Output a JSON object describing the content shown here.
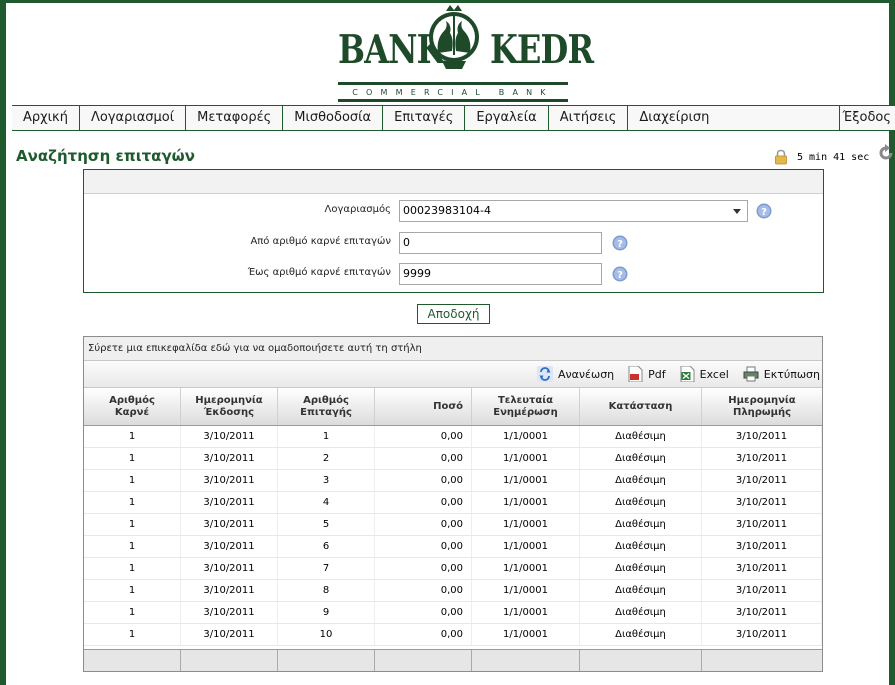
{
  "brand": {
    "left_word": "BANK",
    "right_word": "KEDR",
    "subtitle": "COMMERCIAL BANK",
    "color": "#1f4a2a"
  },
  "nav": {
    "items": [
      "Αρχική",
      "Λογαριασμοί",
      "Μεταφορές",
      "Μισθοδοσία",
      "Επιταγές",
      "Εργαλεία",
      "Αιτήσεις",
      "Διαχείριση"
    ],
    "exit_label": "Έξοδος"
  },
  "page": {
    "title": "Αναζήτηση επιταγών",
    "session_time": "5 min 41 sec"
  },
  "form": {
    "account_label": "Λογαριασμός",
    "account_value": "00023983104-4",
    "from_label": "Από αριθμό καρνέ επιταγών",
    "from_value": "0",
    "to_label": "Έως αριθμό καρνέ επιταγών",
    "to_value": "9999",
    "accept_label": "Αποδοχή"
  },
  "grid": {
    "group_hint": "Σύρετε μια επικεφαλίδα εδώ για να ομαδοποιήσετε αυτή τη στήλη",
    "toolbar": {
      "refresh": "Ανανέωση",
      "pdf": "Pdf",
      "excel": "Excel",
      "print": "Εκτύπωση"
    },
    "headers": [
      [
        "Αριθμός",
        "Καρνέ"
      ],
      [
        "Ημερομηνία",
        "Έκδοσης"
      ],
      [
        "Αριθμός",
        "Επιταγής"
      ],
      [
        "Ποσό",
        ""
      ],
      [
        "Τελευταία",
        "Ενημέρωση"
      ],
      [
        "Κατάσταση",
        ""
      ],
      [
        "Ημερομηνία",
        "Πληρωμής"
      ]
    ],
    "rows": [
      [
        "1",
        "3/10/2011",
        "1",
        "0,00",
        "1/1/0001",
        "Διαθέσιμη",
        "3/10/2011"
      ],
      [
        "1",
        "3/10/2011",
        "2",
        "0,00",
        "1/1/0001",
        "Διαθέσιμη",
        "3/10/2011"
      ],
      [
        "1",
        "3/10/2011",
        "3",
        "0,00",
        "1/1/0001",
        "Διαθέσιμη",
        "3/10/2011"
      ],
      [
        "1",
        "3/10/2011",
        "4",
        "0,00",
        "1/1/0001",
        "Διαθέσιμη",
        "3/10/2011"
      ],
      [
        "1",
        "3/10/2011",
        "5",
        "0,00",
        "1/1/0001",
        "Διαθέσιμη",
        "3/10/2011"
      ],
      [
        "1",
        "3/10/2011",
        "6",
        "0,00",
        "1/1/0001",
        "Διαθέσιμη",
        "3/10/2011"
      ],
      [
        "1",
        "3/10/2011",
        "7",
        "0,00",
        "1/1/0001",
        "Διαθέσιμη",
        "3/10/2011"
      ],
      [
        "1",
        "3/10/2011",
        "8",
        "0,00",
        "1/1/0001",
        "Διαθέσιμη",
        "3/10/2011"
      ],
      [
        "1",
        "3/10/2011",
        "9",
        "0,00",
        "1/1/0001",
        "Διαθέσιμη",
        "3/10/2011"
      ],
      [
        "1",
        "3/10/2011",
        "10",
        "0,00",
        "1/1/0001",
        "Διαθέσιμη",
        "3/10/2011"
      ]
    ]
  },
  "icons": {
    "lock": "lock-icon",
    "refresh": "refresh-icon",
    "help": "help-icon",
    "pdf": "pdf-icon",
    "excel": "excel-icon",
    "print": "print-icon"
  },
  "colors": {
    "accent": "#1f5a2e",
    "help": "#6d8fc4"
  }
}
